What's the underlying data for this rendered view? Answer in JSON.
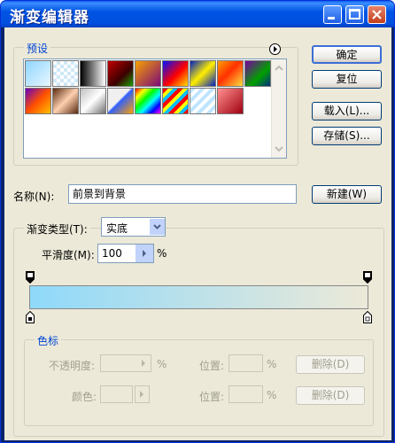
{
  "window": {
    "title": "渐变编辑器"
  },
  "presets": {
    "label": "预设",
    "swatches": [
      {
        "name": "preset-1",
        "bg": "linear-gradient(135deg,#8fd6ff,#e8f7ff)"
      },
      {
        "name": "preset-2",
        "bg": "repeating-conic-gradient(#cfe8f7 0% 25%, #fff 0% 50%) 0 0/8px 8px"
      },
      {
        "name": "preset-3",
        "bg": "linear-gradient(90deg,#000,#fff)"
      },
      {
        "name": "preset-4",
        "bg": "linear-gradient(135deg,#c40000,#3a0000 60%,#1aa000)"
      },
      {
        "name": "preset-5",
        "bg": "linear-gradient(135deg,#f8a000,#7a0a7a)"
      },
      {
        "name": "preset-6",
        "bg": "linear-gradient(135deg,#0010ff,#ff0000 55%,#ffe000)"
      },
      {
        "name": "preset-7",
        "bg": "linear-gradient(135deg,#0020c0,#ffee00 50%,#0020c0)"
      },
      {
        "name": "preset-8",
        "bg": "linear-gradient(135deg,#ffa000,#ff3000 45%,#ffe040)"
      },
      {
        "name": "preset-9",
        "bg": "linear-gradient(135deg,#7a00a0,#00a000 60%,#003080)"
      },
      {
        "name": "preset-10",
        "bg": "linear-gradient(135deg,#6a00c0,#ff5000 50%,#ffc000)"
      },
      {
        "name": "preset-11",
        "bg": "linear-gradient(135deg,#5a2a10,#ffd0b0 50%,#5a2a10)"
      },
      {
        "name": "preset-12",
        "bg": "linear-gradient(135deg,#c0c0c0,#ffffff 50%,#707070)"
      },
      {
        "name": "preset-13",
        "bg": "linear-gradient(135deg,#f0f0f0,#f0f0f0 45%,#3060ff 50%,#ffa000)"
      },
      {
        "name": "preset-14",
        "bg": "linear-gradient(135deg,#ff0000,#ffff00,#00ff00,#00ffff,#0000ff,#ff00ff)"
      },
      {
        "name": "preset-15",
        "bg": "repeating-linear-gradient(135deg,#ff0000 0 4px,#ffff00 4px 8px,#00c0ff 8px 12px)"
      },
      {
        "name": "preset-16",
        "bg": "repeating-linear-gradient(135deg,#bfe4ff 0 4px,#fff 4px 8px)"
      },
      {
        "name": "preset-17",
        "bg": "linear-gradient(135deg,#ff9090,#a00010)"
      }
    ]
  },
  "buttons": {
    "ok": "确定",
    "reset": "复位",
    "load": "载入(L)...",
    "save": "存储(S)...",
    "new": "新建(W)"
  },
  "name": {
    "label": "名称(N):",
    "value": "前景到背景"
  },
  "gradient": {
    "type_label": "渐变类型(T):",
    "type_value": "实底",
    "smooth_label": "平滑度(M):",
    "smooth_value": "100",
    "percent": "%",
    "bar_from": "#8fd9fa",
    "bar_to": "#ece9d8"
  },
  "stops": {
    "label": "色标",
    "opacity_label": "不透明度:",
    "opacity_unit": "%",
    "location_label": "位置:",
    "location_unit": "%",
    "delete": "删除(D)",
    "color_label": "颜色:",
    "location2_label": "位置:",
    "location2_unit": "%",
    "delete2": "删除(D)"
  }
}
